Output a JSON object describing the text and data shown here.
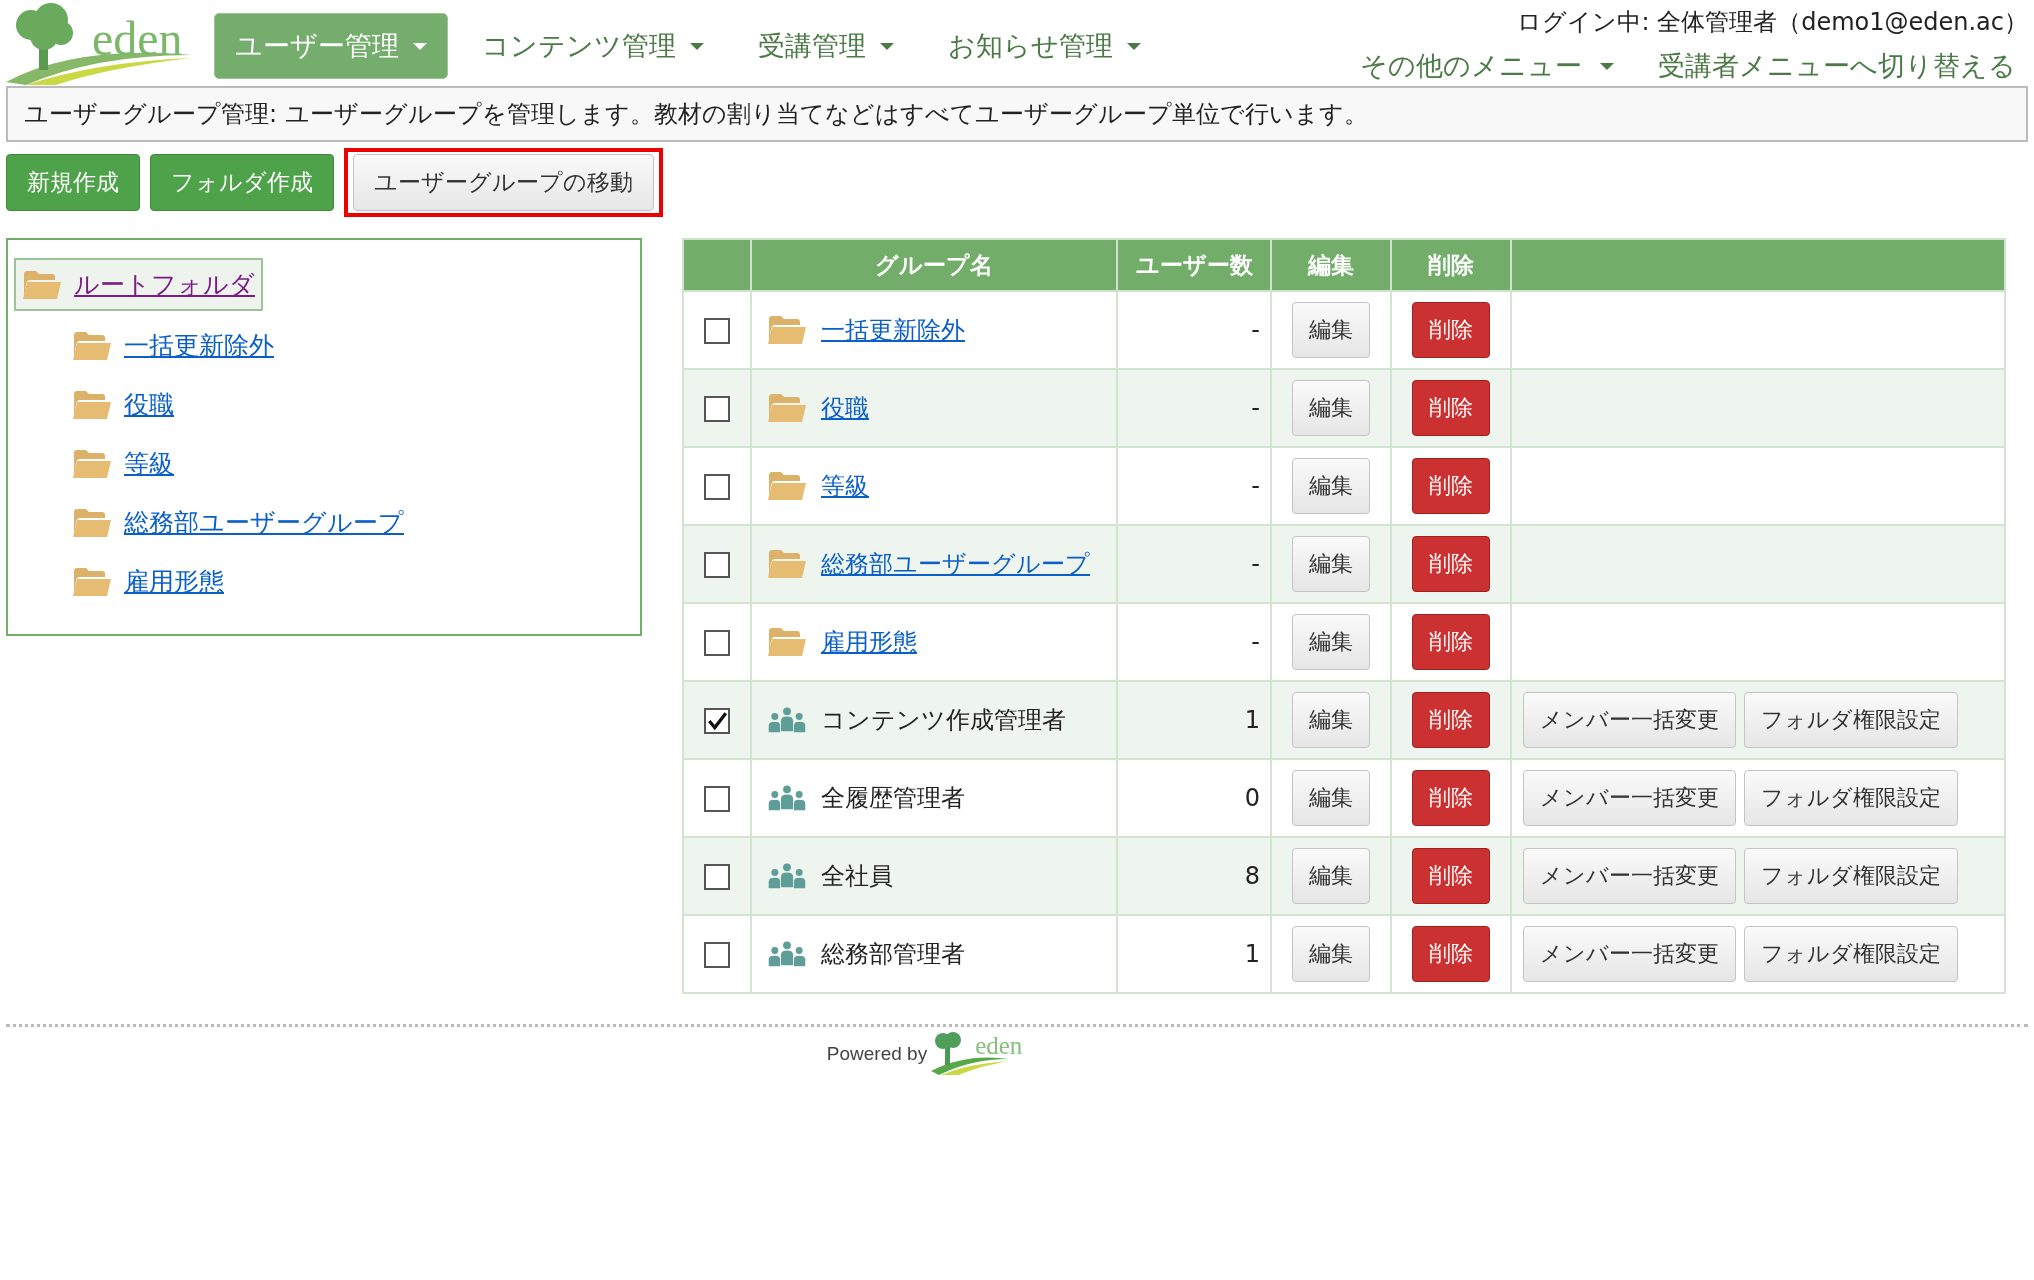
{
  "logo": {
    "text": "eden"
  },
  "nav": [
    {
      "label": "ユーザー管理",
      "selected": true
    },
    {
      "label": "コンテンツ管理",
      "selected": false
    },
    {
      "label": "受講管理",
      "selected": false
    },
    {
      "label": "お知らせ管理",
      "selected": false
    }
  ],
  "login_status": "ログイン中: 全体管理者（demo1@eden.ac）",
  "header_links": [
    {
      "label": "その他のメニュー",
      "dropdown": true
    },
    {
      "label": "受講者メニューへ切り替える",
      "dropdown": false
    }
  ],
  "description": "ユーザーグループ管理: ユーザーグループを管理します。教材の割り当てなどはすべてユーザーグループ単位で行います。",
  "actions": [
    {
      "label": "新規作成",
      "kind": "primary",
      "highlighted": false
    },
    {
      "label": "フォルダ作成",
      "kind": "primary",
      "highlighted": false
    },
    {
      "label": "ユーザーグループの移動",
      "kind": "default",
      "highlighted": true
    }
  ],
  "tree": {
    "label": "ルートフォルダ",
    "selected": true,
    "children": [
      {
        "label": "一括更新除外",
        "selected": false
      },
      {
        "label": "役職",
        "selected": false
      },
      {
        "label": "等級",
        "selected": false
      },
      {
        "label": "総務部ユーザーグループ",
        "selected": false
      },
      {
        "label": "雇用形態",
        "selected": false
      }
    ]
  },
  "table": {
    "columns": [
      "グループ名",
      "ユーザー数",
      "編集",
      "削除"
    ],
    "rows": [
      {
        "kind": "folder",
        "checked": false,
        "name": "一括更新除外",
        "count": "-",
        "edit": "編集",
        "delete": "削除",
        "extra_buttons": []
      },
      {
        "kind": "folder",
        "checked": false,
        "name": "役職",
        "count": "-",
        "edit": "編集",
        "delete": "削除",
        "extra_buttons": []
      },
      {
        "kind": "folder",
        "checked": false,
        "name": "等級",
        "count": "-",
        "edit": "編集",
        "delete": "削除",
        "extra_buttons": []
      },
      {
        "kind": "folder",
        "checked": false,
        "name": "総務部ユーザーグループ",
        "count": "-",
        "edit": "編集",
        "delete": "削除",
        "extra_buttons": []
      },
      {
        "kind": "folder",
        "checked": false,
        "name": "雇用形態",
        "count": "-",
        "edit": "編集",
        "delete": "削除",
        "extra_buttons": []
      },
      {
        "kind": "group",
        "checked": true,
        "name": "コンテンツ作成管理者",
        "count": "1",
        "edit": "編集",
        "delete": "削除",
        "extra_buttons": [
          "メンバー一括変更",
          "フォルダ権限設定"
        ]
      },
      {
        "kind": "group",
        "checked": false,
        "name": "全履歴管理者",
        "count": "0",
        "edit": "編集",
        "delete": "削除",
        "extra_buttons": [
          "メンバー一括変更",
          "フォルダ権限設定"
        ]
      },
      {
        "kind": "group",
        "checked": false,
        "name": "全社員",
        "count": "8",
        "edit": "編集",
        "delete": "削除",
        "extra_buttons": [
          "メンバー一括変更",
          "フォルダ権限設定"
        ]
      },
      {
        "kind": "group",
        "checked": false,
        "name": "総務部管理者",
        "count": "1",
        "edit": "編集",
        "delete": "削除",
        "extra_buttons": [
          "メンバー一括変更",
          "フォルダ権限設定"
        ]
      }
    ]
  },
  "footer": {
    "powered_by": "Powered by",
    "logo_text": "eden"
  }
}
